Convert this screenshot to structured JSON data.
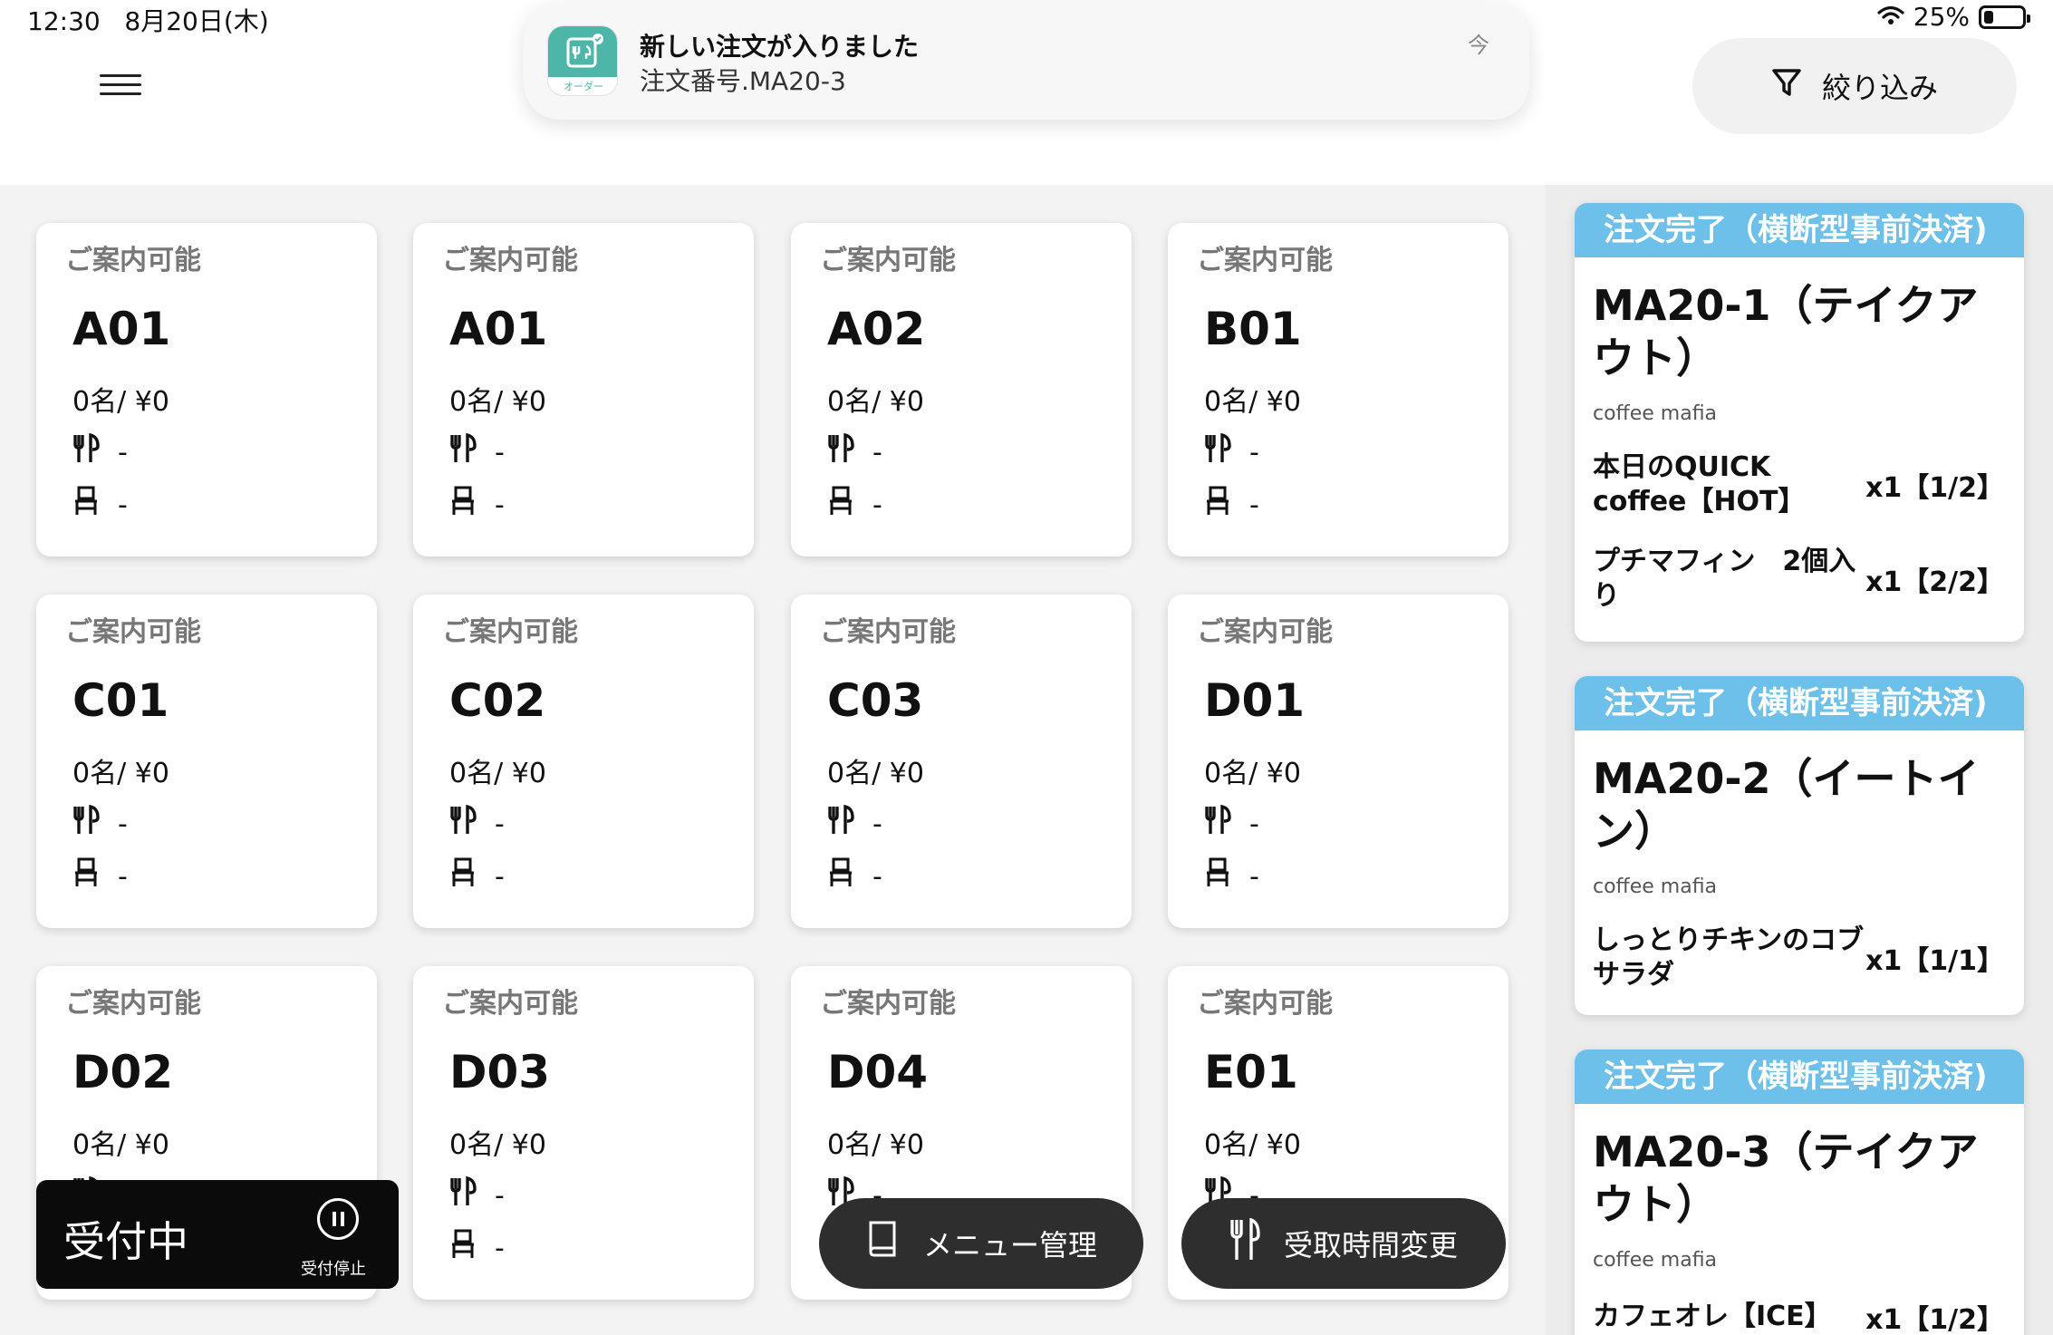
{
  "status_bar": {
    "time": "12:30",
    "date": "8月20日(木)",
    "battery": "25%",
    "battery_level": 0.25
  },
  "notification": {
    "app_label": "オーダー",
    "title": "新しい注文が入りました",
    "subtitle": "注文番号.MA20-3",
    "time": "今"
  },
  "header": {
    "filter_label": "絞り込み"
  },
  "tables": [
    {
      "status": "ご案内可能",
      "name": "A01",
      "info": "0名/ ¥0",
      "dish": "-",
      "seat": "-"
    },
    {
      "status": "ご案内可能",
      "name": "A01",
      "info": "0名/ ¥0",
      "dish": "-",
      "seat": "-"
    },
    {
      "status": "ご案内可能",
      "name": "A02",
      "info": "0名/ ¥0",
      "dish": "-",
      "seat": "-"
    },
    {
      "status": "ご案内可能",
      "name": "B01",
      "info": "0名/ ¥0",
      "dish": "-",
      "seat": "-"
    },
    {
      "status": "ご案内可能",
      "name": "C01",
      "info": "0名/ ¥0",
      "dish": "-",
      "seat": "-"
    },
    {
      "status": "ご案内可能",
      "name": "C02",
      "info": "0名/ ¥0",
      "dish": "-",
      "seat": "-"
    },
    {
      "status": "ご案内可能",
      "name": "C03",
      "info": "0名/ ¥0",
      "dish": "-",
      "seat": "-"
    },
    {
      "status": "ご案内可能",
      "name": "D01",
      "info": "0名/ ¥0",
      "dish": "-",
      "seat": "-"
    },
    {
      "status": "ご案内可能",
      "name": "D02",
      "info": "0名/ ¥0",
      "dish": "-",
      "seat": "-"
    },
    {
      "status": "ご案内可能",
      "name": "D03",
      "info": "0名/ ¥0",
      "dish": "-",
      "seat": "-"
    },
    {
      "status": "ご案内可能",
      "name": "D04",
      "info": "0名/ ¥0",
      "dish": "-",
      "seat": "-"
    },
    {
      "status": "ご案内可能",
      "name": "E01",
      "info": "0名/ ¥0",
      "dish": "-",
      "seat": "-"
    }
  ],
  "orders": [
    {
      "header": "注文完了（横断型事前決済)",
      "title": "MA20-1（テイクアウト）",
      "shop": "coffee mafia",
      "items": [
        {
          "name": "本日のQUICK coffee【HOT】",
          "qty": "x1【1/2】"
        },
        {
          "name": "プチマフィン　2個入り",
          "qty": "x1【2/2】"
        }
      ]
    },
    {
      "header": "注文完了（横断型事前決済)",
      "title": "MA20-2（イートイン）",
      "shop": "coffee mafia",
      "items": [
        {
          "name": "しっとりチキンのコブサラダ",
          "qty": "x1【1/1】"
        }
      ]
    },
    {
      "header": "注文完了（横断型事前決済)",
      "title": "MA20-3（テイクアウト）",
      "shop": "coffee mafia",
      "items": [
        {
          "name": "カフェオレ【ICE】",
          "qty": "x1【1/2】"
        }
      ]
    }
  ],
  "controls": {
    "accepting_label": "受付中",
    "pause_label": "受付停止",
    "menu_manage_label": "メニュー管理",
    "pickup_change_label": "受取時間変更"
  },
  "icons": {
    "menu": "hamburger-icon",
    "filter": "filter-funnel-icon",
    "dish": "fork-knife-icon",
    "seat": "chair-icon",
    "pause": "pause-circle-icon",
    "book": "book-icon",
    "wifi": "wifi-icon",
    "battery": "battery-icon"
  },
  "colors": {
    "order_header": "#6cc0ea",
    "app_icon": "#4db6a8",
    "accept_bg": "#0b0b0b",
    "pill_bg": "#2e2e2e"
  }
}
